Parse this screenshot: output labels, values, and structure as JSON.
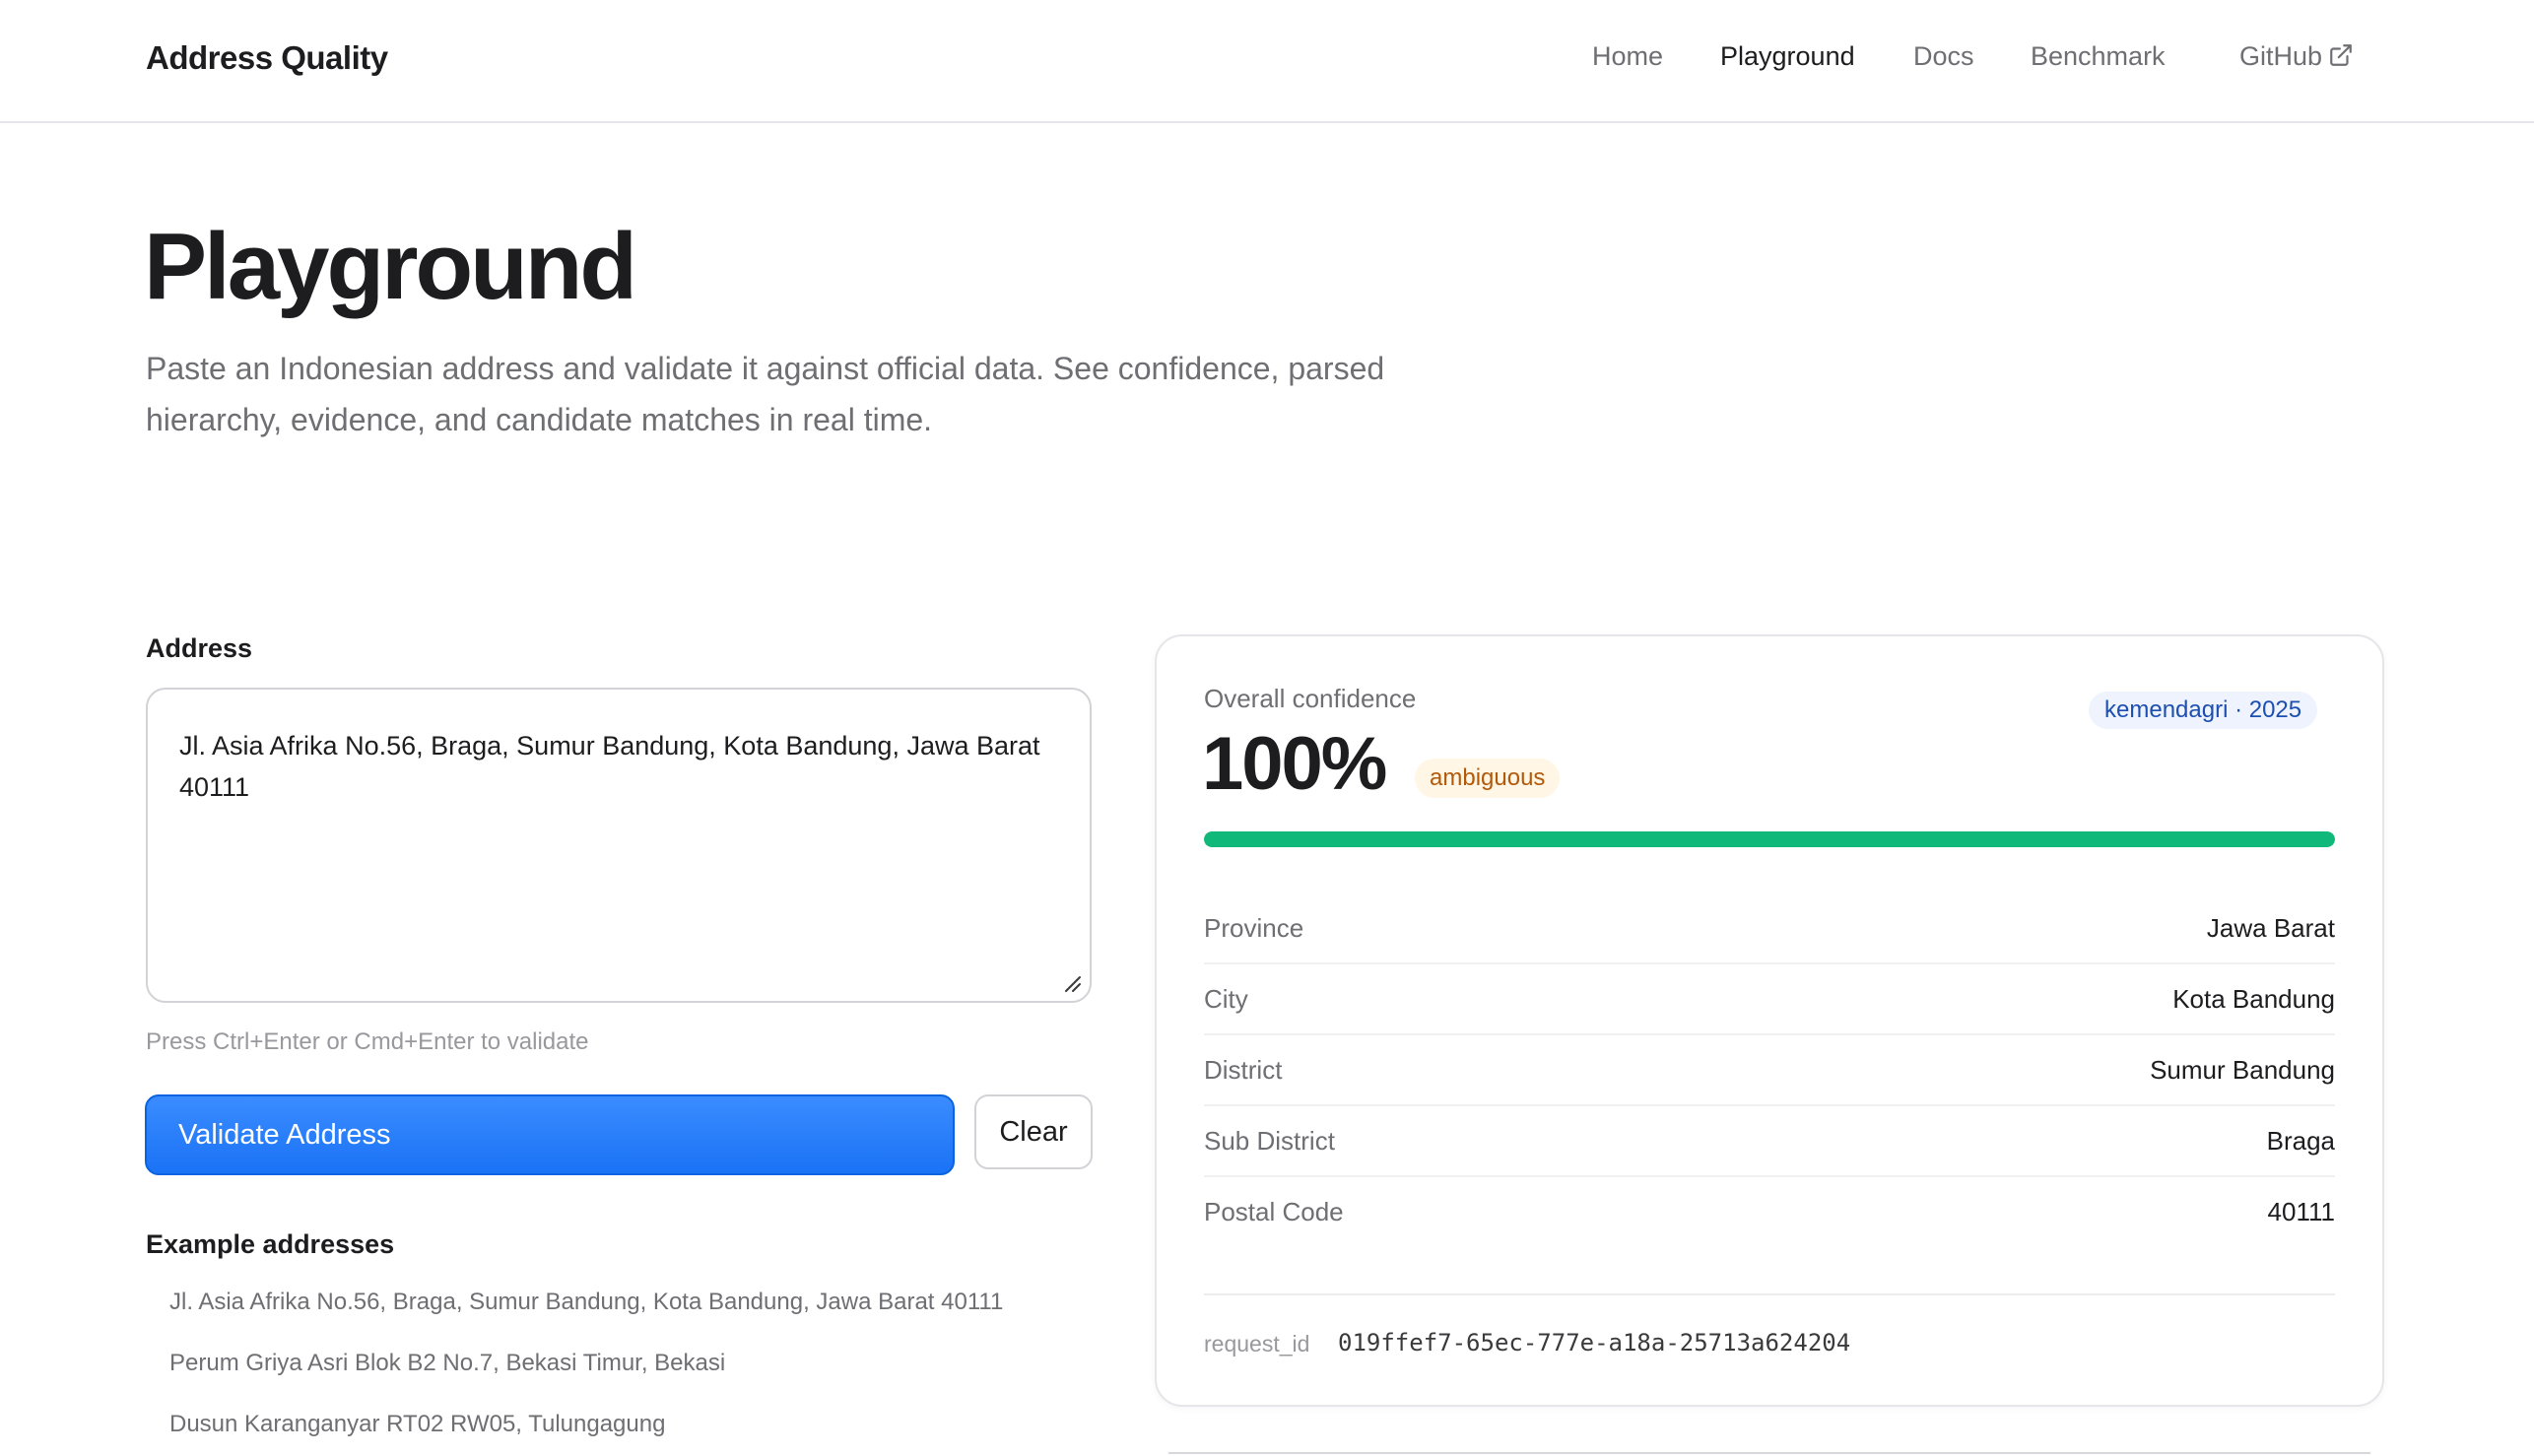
{
  "nav": {
    "brand": "Address Quality",
    "links": [
      {
        "label": "Home",
        "active": false
      },
      {
        "label": "Playground",
        "active": true
      },
      {
        "label": "Docs",
        "active": false
      },
      {
        "label": "Benchmark",
        "active": false
      },
      {
        "label": "GitHub",
        "active": false,
        "icon": "external-link-icon"
      }
    ]
  },
  "hero": {
    "title": "Playground",
    "description": "Paste an Indonesian address and validate it against official data. See confidence, parsed hierarchy, evidence, and candidate matches in real time."
  },
  "form": {
    "address_label": "Address",
    "address_value": "Jl. Asia Afrika No.56, Braga, Sumur Bandung, Kota Bandung, Jawa Barat 40111",
    "hint": "Press Ctrl+Enter or Cmd+Enter to validate",
    "validate_label": "Validate Address",
    "clear_label": "Clear",
    "examples_title": "Example addresses",
    "examples": [
      "Jl. Asia Afrika No.56, Braga, Sumur Bandung, Kota Bandung, Jawa Barat 40111",
      "Perum Griya Asri Blok B2 No.7, Bekasi Timur, Bekasi",
      "Dusun Karanganyar RT02 RW05, Tulungagung"
    ]
  },
  "result": {
    "confidence_label": "Overall confidence",
    "confidence_value": "100%",
    "confidence_fraction": 1.0,
    "status": "ambiguous",
    "source": "kemendagri · 2025",
    "colors": {
      "progress": "#10b97a",
      "status_bg": "#fff6e5",
      "status_text": "#b3590a",
      "source_bg": "#eef3fd",
      "source_text": "#1d4fb0",
      "accent": "#1a72f5"
    },
    "hierarchy": [
      {
        "label": "Province",
        "value": "Jawa Barat"
      },
      {
        "label": "City",
        "value": "Kota Bandung"
      },
      {
        "label": "District",
        "value": "Sumur Bandung"
      },
      {
        "label": "Sub District",
        "value": "Braga"
      },
      {
        "label": "Postal Code",
        "value": "40111"
      }
    ],
    "request_id_label": "request_id",
    "request_id": "019ffef7-65ec-777e-a18a-25713a624204"
  }
}
